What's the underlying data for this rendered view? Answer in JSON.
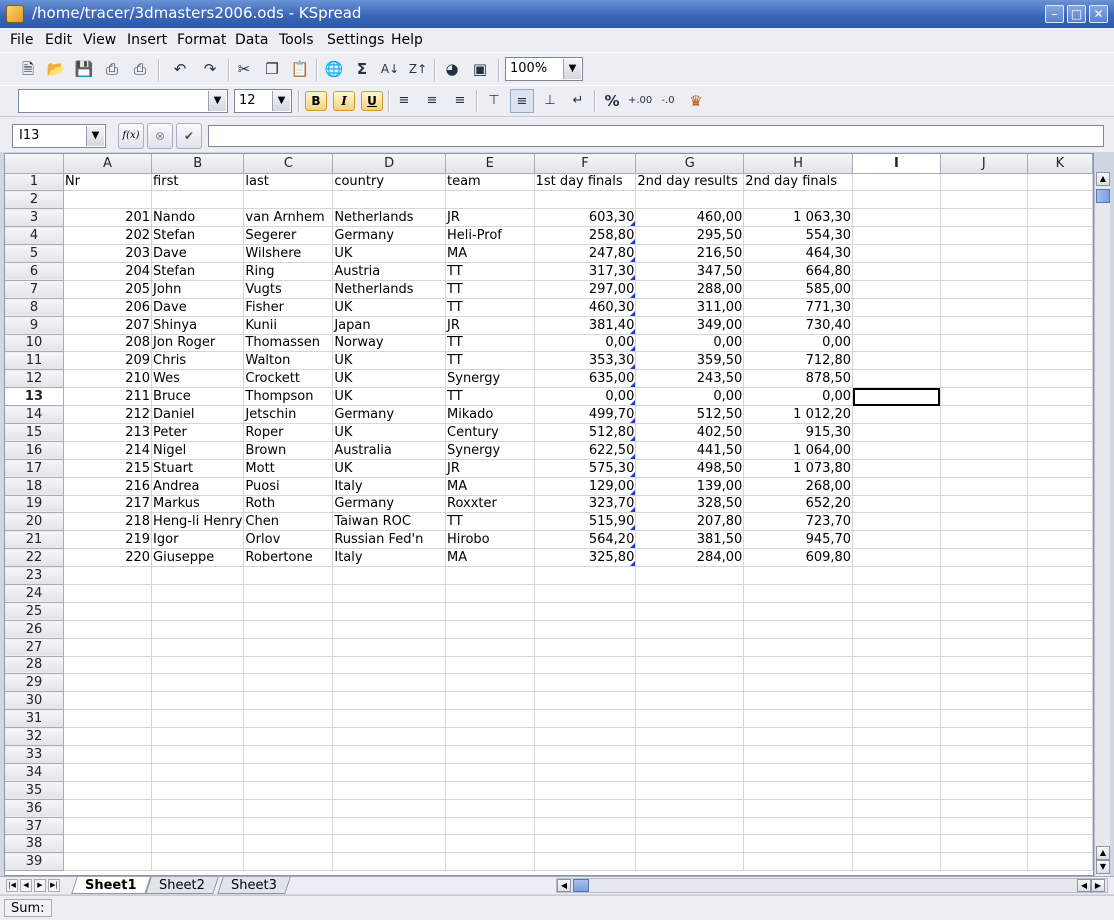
{
  "window": {
    "title": "/home/tracer/3dmasters2006.ods - KSpread",
    "controls": [
      "minimize",
      "maximize",
      "close"
    ]
  },
  "menu": [
    "File",
    "Edit",
    "View",
    "Insert",
    "Format",
    "Data",
    "Tools",
    "Settings",
    "Help"
  ],
  "toolbar": {
    "zoom": "100%",
    "font_name": "",
    "font_size": "12",
    "bold": "B",
    "italic": "I",
    "underline": "U",
    "sum_glyph": "Σ",
    "percent_glyph": "%"
  },
  "formula_bar": {
    "cell_ref": "I13",
    "fx_label": "f(x)",
    "formula": ""
  },
  "sheet": {
    "columns": [
      "A",
      "B",
      "C",
      "D",
      "E",
      "F",
      "G",
      "H",
      "I",
      "J",
      "K"
    ],
    "active_column": "I",
    "active_row": 13,
    "row_count": 39,
    "selected_cell": "I13",
    "header_row": [
      "Nr",
      "first",
      "last",
      "country",
      "team",
      "1st day finals",
      "2nd day results",
      "2nd day finals"
    ],
    "data_rows": [
      [
        "201",
        "Nando",
        "van Arnhem",
        "Netherlands",
        "JR",
        "603,30",
        "460,00",
        "1 063,30"
      ],
      [
        "202",
        "Stefan",
        "Segerer",
        "Germany",
        "Heli-Prof",
        "258,80",
        "295,50",
        "554,30"
      ],
      [
        "203",
        "Dave",
        "Wilshere",
        "UK",
        "MA",
        "247,80",
        "216,50",
        "464,30"
      ],
      [
        "204",
        "Stefan",
        "Ring",
        "Austria",
        "TT",
        "317,30",
        "347,50",
        "664,80"
      ],
      [
        "205",
        "John",
        "Vugts",
        "Netherlands",
        "TT",
        "297,00",
        "288,00",
        "585,00"
      ],
      [
        "206",
        "Dave",
        "Fisher",
        "UK",
        "TT",
        "460,30",
        "311,00",
        "771,30"
      ],
      [
        "207",
        "Shinya",
        "Kunii",
        "Japan",
        "JR",
        "381,40",
        "349,00",
        "730,40"
      ],
      [
        "208",
        "Jon Roger",
        "Thomassen",
        "Norway",
        "TT",
        "0,00",
        "0,00",
        "0,00"
      ],
      [
        "209",
        "Chris",
        "Walton",
        "UK",
        "TT",
        "353,30",
        "359,50",
        "712,80"
      ],
      [
        "210",
        "Wes",
        "Crockett",
        "UK",
        "Synergy",
        "635,00",
        "243,50",
        "878,50"
      ],
      [
        "211",
        "Bruce",
        "Thompson",
        "UK",
        "TT",
        "0,00",
        "0,00",
        "0,00"
      ],
      [
        "212",
        "Daniel",
        "Jetschin",
        "Germany",
        "Mikado",
        "499,70",
        "512,50",
        "1 012,20"
      ],
      [
        "213",
        "Peter",
        "Roper",
        "UK",
        "Century",
        "512,80",
        "402,50",
        "915,30"
      ],
      [
        "214",
        "Nigel",
        "Brown",
        "Australia",
        "Synergy",
        "622,50",
        "441,50",
        "1 064,00"
      ],
      [
        "215",
        "Stuart",
        "Mott",
        "UK",
        "JR",
        "575,30",
        "498,50",
        "1 073,80"
      ],
      [
        "216",
        "Andrea",
        "Puosi",
        "Italy",
        "MA",
        "129,00",
        "139,00",
        "268,00"
      ],
      [
        "217",
        "Markus",
        "Roth",
        "Germany",
        "Roxxter",
        "323,70",
        "328,50",
        "652,20"
      ],
      [
        "218",
        "Heng-li Henry",
        "Chen",
        "Taiwan ROC",
        "TT",
        "515,90",
        "207,80",
        "723,70"
      ],
      [
        "219",
        "Igor",
        "Orlov",
        "Russian Fed'n",
        "Hirobo",
        "564,20",
        "381,50",
        "945,70"
      ],
      [
        "220",
        "Giuseppe",
        "Robertone",
        "Italy",
        "MA",
        "325,80",
        "284,00",
        "609,80"
      ]
    ]
  },
  "tabs": [
    {
      "label": "Sheet1",
      "active": true
    },
    {
      "label": "Sheet2",
      "active": false
    },
    {
      "label": "Sheet3",
      "active": false
    }
  ],
  "status": {
    "sum_label": "Sum:"
  },
  "colors": {
    "title_gradient_top": "#6a93d6",
    "title_gradient_bottom": "#2f5aa8",
    "note_marker": "#1a3ad0",
    "chrome": "#eceef3"
  }
}
